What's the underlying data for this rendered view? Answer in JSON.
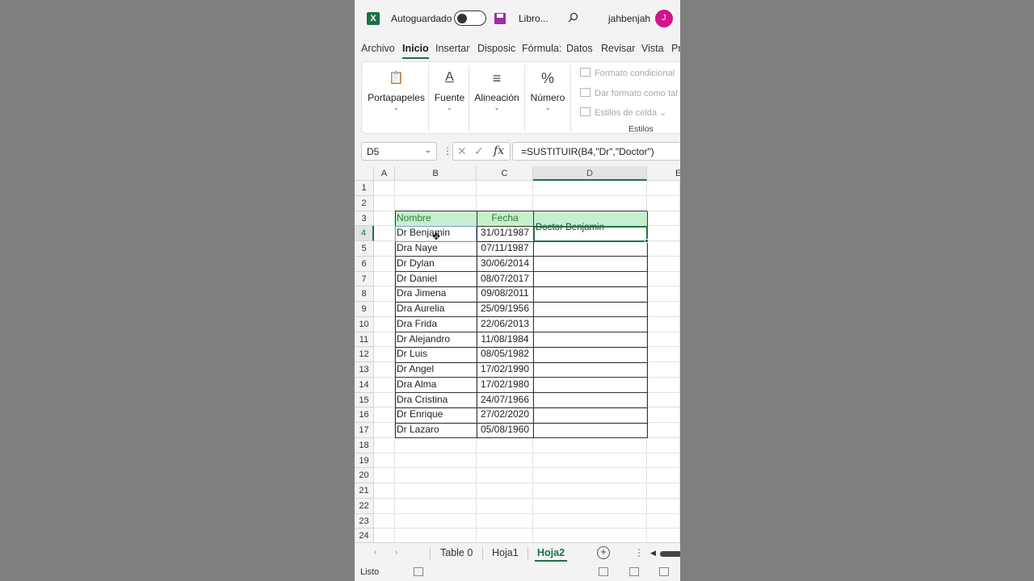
{
  "title_bar": {
    "autosave_label": "Autoguardado",
    "filename": "Libro...",
    "username": "jahbenjah",
    "avatar_initial": "J",
    "logo_letter": "X"
  },
  "ribbon_tabs": [
    "Archivo",
    "Inicio",
    "Insertar",
    "Disposic",
    "Fórmula:",
    "Datos",
    "Revisar",
    "Vista",
    "Pr"
  ],
  "active_tab": "Inicio",
  "ribbon": {
    "groups": [
      {
        "label": "Portapapeles",
        "icon": "📋"
      },
      {
        "label": "Fuente",
        "icon": "A"
      },
      {
        "label": "Alineación",
        "icon": "≡"
      },
      {
        "label": "Número",
        "icon": "%"
      }
    ],
    "chevron": "⌄",
    "styles": [
      "Formato condicional",
      "Dar formato como tal",
      "Estilos de celda ⌄"
    ],
    "styles_group_label": "Estilos"
  },
  "formula_bar": {
    "name_box": "D5",
    "formula": "=SUSTITUIR(B4,\"Dr\",\"Doctor\")",
    "fx_label": "fx"
  },
  "grid": {
    "columns": [
      "A",
      "B",
      "C",
      "D",
      "E"
    ],
    "selected_column": "D",
    "selected_row": 4,
    "row_numbers": [
      1,
      2,
      3,
      4,
      5,
      6,
      7,
      8,
      9,
      10,
      11,
      12,
      13,
      14,
      15,
      16,
      17,
      18,
      19,
      20,
      21,
      22,
      23,
      24
    ],
    "header_row": {
      "nombre": "Nombre",
      "fecha": "Fecha"
    },
    "table_rows": [
      {
        "nombre": "Dr Benjamin",
        "fecha": "31/01/1987"
      },
      {
        "nombre": "Dra Naye",
        "fecha": "07/11/1987"
      },
      {
        "nombre": "Dr Dylan",
        "fecha": "30/06/2014"
      },
      {
        "nombre": "Dr Daniel",
        "fecha": "08/07/2017"
      },
      {
        "nombre": "Dra Jimena",
        "fecha": "09/08/2011"
      },
      {
        "nombre": "Dra Aurelia",
        "fecha": "25/09/1956"
      },
      {
        "nombre": "Dra Frida",
        "fecha": "22/06/2013"
      },
      {
        "nombre": "Dr Alejandro",
        "fecha": "11/08/1984"
      },
      {
        "nombre": "Dr Luis",
        "fecha": "08/05/1982"
      },
      {
        "nombre": "Dr Angel",
        "fecha": "17/02/1990"
      },
      {
        "nombre": "Dra Alma",
        "fecha": "17/02/1980"
      },
      {
        "nombre": "Dra Cristina",
        "fecha": "24/07/1966"
      },
      {
        "nombre": "Dr Enrique",
        "fecha": "27/02/2020"
      },
      {
        "nombre": "Dr Lazaro",
        "fecha": "05/08/1960"
      }
    ],
    "d4_value": "Doctor Benjamin"
  },
  "sheet_tabs": [
    "Table 0",
    "Hoja1",
    "Hoja2"
  ],
  "active_sheet": "Hoja2",
  "status": {
    "text": "Listo"
  },
  "colors": {
    "accent": "#1d7245",
    "header_fill": "#c6efce",
    "header_text": "#2e7d32",
    "avatar": "#d1148a"
  }
}
